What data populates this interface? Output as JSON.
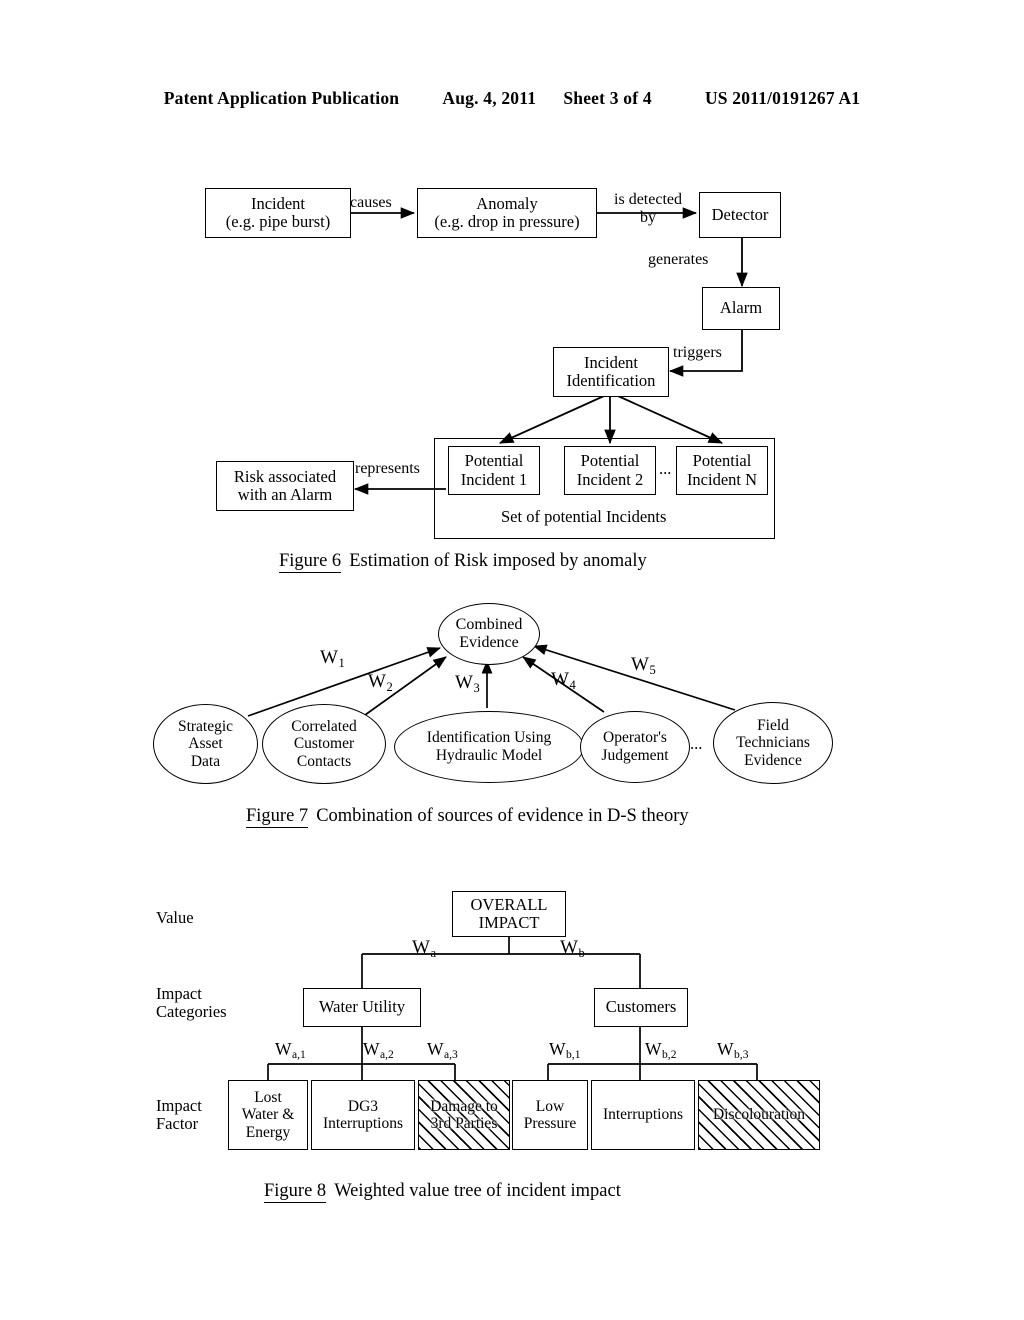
{
  "header": {
    "publication": "Patent Application Publication",
    "date": "Aug. 4, 2011",
    "sheet": "Sheet 3 of 4",
    "number": "US 2011/0191267 A1"
  },
  "figure6": {
    "caption_number": "Figure 6",
    "caption_text": "Estimation of Risk imposed by anomaly",
    "nodes": {
      "incident": "Incident\n(e.g. pipe burst)",
      "incident_l1": "Incident",
      "incident_l2": "(e.g. pipe burst)",
      "anomaly_l1": "Anomaly",
      "anomaly_l2": "(e.g. drop in pressure)",
      "detector": "Detector",
      "alarm": "Alarm",
      "incident_identification_l1": "Incident",
      "incident_identification_l2": "Identification",
      "potential_1_l1": "Potential",
      "potential_1_l2": "Incident 1",
      "potential_2_l1": "Potential",
      "potential_2_l2": "Incident 2",
      "potential_n_l1": "Potential",
      "potential_n_l2": "Incident N",
      "ellipsis": "...",
      "set_label": "Set of potential Incidents",
      "risk_l1": "Risk associated",
      "risk_l2": "with an Alarm"
    },
    "edges": {
      "causes": "causes",
      "is_detected_l1": "is detected",
      "is_detected_l2": "by",
      "generates": "generates",
      "triggers": "triggers",
      "represents": "represents"
    }
  },
  "figure7": {
    "caption_number": "Figure 7",
    "caption_text": "Combination of sources of evidence in D-S theory",
    "nodes": {
      "combined_l1": "Combined",
      "combined_l2": "Evidence",
      "strategic_l1": "Strategic",
      "strategic_l2": "Asset",
      "strategic_l3": "Data",
      "correlated_l1": "Correlated",
      "correlated_l2": "Customer",
      "correlated_l3": "Contacts",
      "hydraulic_l1": "Identification Using",
      "hydraulic_l2": "Hydraulic Model",
      "operator_l1": "Operator's",
      "operator_l2": "Judgement",
      "field_l1": "Field",
      "field_l2": "Technicians",
      "field_l3": "Evidence",
      "ellipsis": "..."
    },
    "weights": {
      "w1_base": "W",
      "w1_sub": "1",
      "w2_base": "W",
      "w2_sub": "2",
      "w3_base": "W",
      "w3_sub": "3",
      "w4_base": "W",
      "w4_sub": "4",
      "w5_base": "W",
      "w5_sub": "5"
    }
  },
  "figure8": {
    "caption_number": "Figure 8",
    "caption_text": "Weighted value tree of incident impact",
    "row_labels": {
      "value": "Value",
      "impact_categories_l1": "Impact",
      "impact_categories_l2": "Categories",
      "impact_factor_l1": "Impact",
      "impact_factor_l2": "Factor"
    },
    "nodes": {
      "overall_l1": "OVERALL",
      "overall_l2": "IMPACT",
      "water_utility": "Water Utility",
      "customers": "Customers",
      "lost_water_l1": "Lost",
      "lost_water_l2": "Water &",
      "lost_water_l3": "Energy",
      "dg3_l1": "DG3",
      "dg3_l2": "Interruptions",
      "damage_l1": "Damage to",
      "damage_l2": "3rd Parties",
      "low_pressure_l1": "Low",
      "low_pressure_l2": "Pressure",
      "interruptions": "Interruptions",
      "discolouration": "Discolouration"
    },
    "weights": {
      "wa_base": "W",
      "wa_sub": "a",
      "wb_base": "W",
      "wb_sub": "b",
      "wa1_base": "W",
      "wa1_sub": "a,1",
      "wa2_base": "W",
      "wa2_sub": "a,2",
      "wa3_base": "W",
      "wa3_sub": "a,3",
      "wb1_base": "W",
      "wb1_sub": "b,1",
      "wb2_base": "W",
      "wb2_sub": "b,2",
      "wb3_base": "W",
      "wb3_sub": "b,3"
    }
  },
  "colors": {
    "ink": "#000000",
    "paper": "#ffffff"
  }
}
